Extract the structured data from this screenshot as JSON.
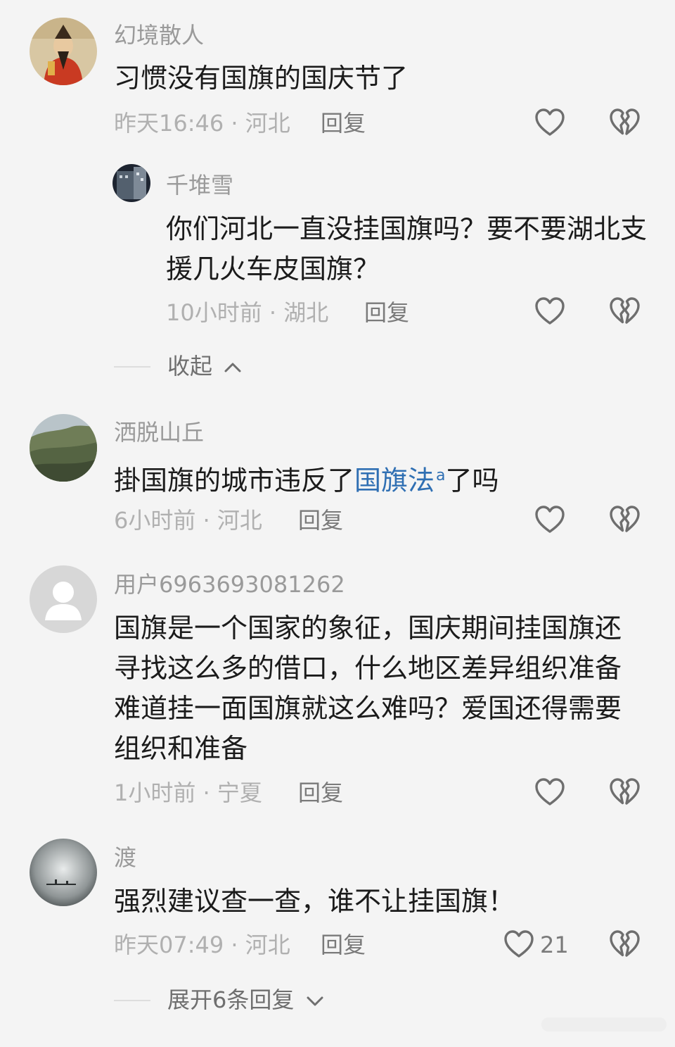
{
  "comments": [
    {
      "username": "幻境散人",
      "text": "习惯没有国旗的国庆节了",
      "meta": "昨天16:46 · 河北",
      "reply_label": "回复"
    },
    {
      "username": "千堆雪",
      "text": "你们河北一直没挂国旗吗？要不要湖北支援几火车皮国旗？",
      "meta": "10小时前 · 湖北",
      "reply_label": "回复"
    },
    {
      "username": "洒脱山丘",
      "text_before": "掛国旗的城市违反了",
      "text_link": "国旗法",
      "text_after": "了吗",
      "meta": "6小时前 · 河北",
      "reply_label": "回复"
    },
    {
      "username": "用户6963693081262",
      "text": "国旗是一个国家的象征，国庆期间挂国旗还寻找这么多的借口，什么地区差异组织准备难道挂一面国旗就这么难吗？爱国还得需要组织和准备",
      "meta": "1小时前 · 宁夏",
      "reply_label": "回复"
    },
    {
      "username": "渡",
      "text": "强烈建议查一查，谁不让挂国旗！",
      "meta": "昨天07:49 · 河北",
      "reply_label": "回复",
      "like_count": "21"
    }
  ],
  "collapse_label": "收起",
  "expand_label": "展开6条回复",
  "icons": {
    "like": "heart-outline-icon",
    "dislike": "broken-heart-icon",
    "collapse": "chevron-up-icon",
    "expand": "chevron-down-icon",
    "search": "search-icon"
  },
  "colors": {
    "background": "#f4f4f4",
    "text": "#1b1b1b",
    "muted": "#9a9a9a",
    "link": "#2f6fb3"
  }
}
